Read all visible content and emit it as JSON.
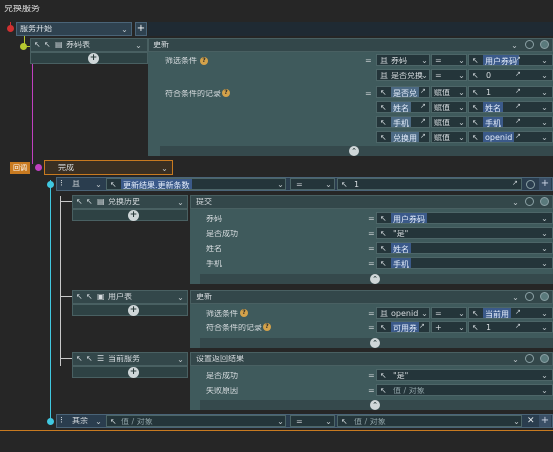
{
  "window": {
    "title": "兑换服务"
  },
  "root": {
    "label": "服务开始"
  },
  "voucher": {
    "table": "券码表",
    "action": "更新",
    "filter_label": "筛选条件",
    "filter_rows": [
      {
        "logic": "且",
        "field": "券码",
        "op": "=",
        "value": "用户券码"
      },
      {
        "logic": "且",
        "field": "是否兑换",
        "op": "=",
        "value": "0"
      }
    ],
    "records_label": "符合条件的记录",
    "assign_rows": [
      {
        "field": "是否兑",
        "op": "赋值",
        "value": "1"
      },
      {
        "field": "姓名",
        "op": "赋值",
        "value": "姓名"
      },
      {
        "field": "手机",
        "op": "赋值",
        "value": "手机"
      },
      {
        "field": "兑换用",
        "op": "赋值",
        "value": "openid"
      }
    ]
  },
  "complete": {
    "tag": "回调",
    "label": "完成"
  },
  "cond": {
    "logic": "且",
    "value_tag": "更新结果.更新条数",
    "op": "=",
    "value": "1"
  },
  "history": {
    "table": "兑换历史",
    "action": "提交",
    "fields": [
      {
        "label": "券码",
        "op": "=",
        "value": "用户券码"
      },
      {
        "label": "是否成功",
        "op": "=",
        "value": "\"是\""
      },
      {
        "label": "姓名",
        "op": "=",
        "value": "姓名"
      },
      {
        "label": "手机",
        "op": "=",
        "value": "手机"
      }
    ]
  },
  "users": {
    "table": "用户表",
    "action": "更新",
    "filter_label": "筛选条件",
    "filter": {
      "logic": "且",
      "field": "openid",
      "op": "=",
      "value": "当前用"
    },
    "records_label": "符合条件的记录",
    "assign": {
      "field": "可用券",
      "op": "+",
      "value": "1"
    }
  },
  "service": {
    "label": "当前服务",
    "action": "设置返回结果",
    "fields": [
      {
        "label": "是否成功",
        "op": "=",
        "value": "\"是\""
      },
      {
        "label": "失败原因",
        "op": "=",
        "value": "值 / 对象"
      }
    ]
  },
  "else": {
    "label": "其余",
    "placeholder": "值 / 对象",
    "op": "=",
    "placeholder2": "值 / 对象"
  }
}
